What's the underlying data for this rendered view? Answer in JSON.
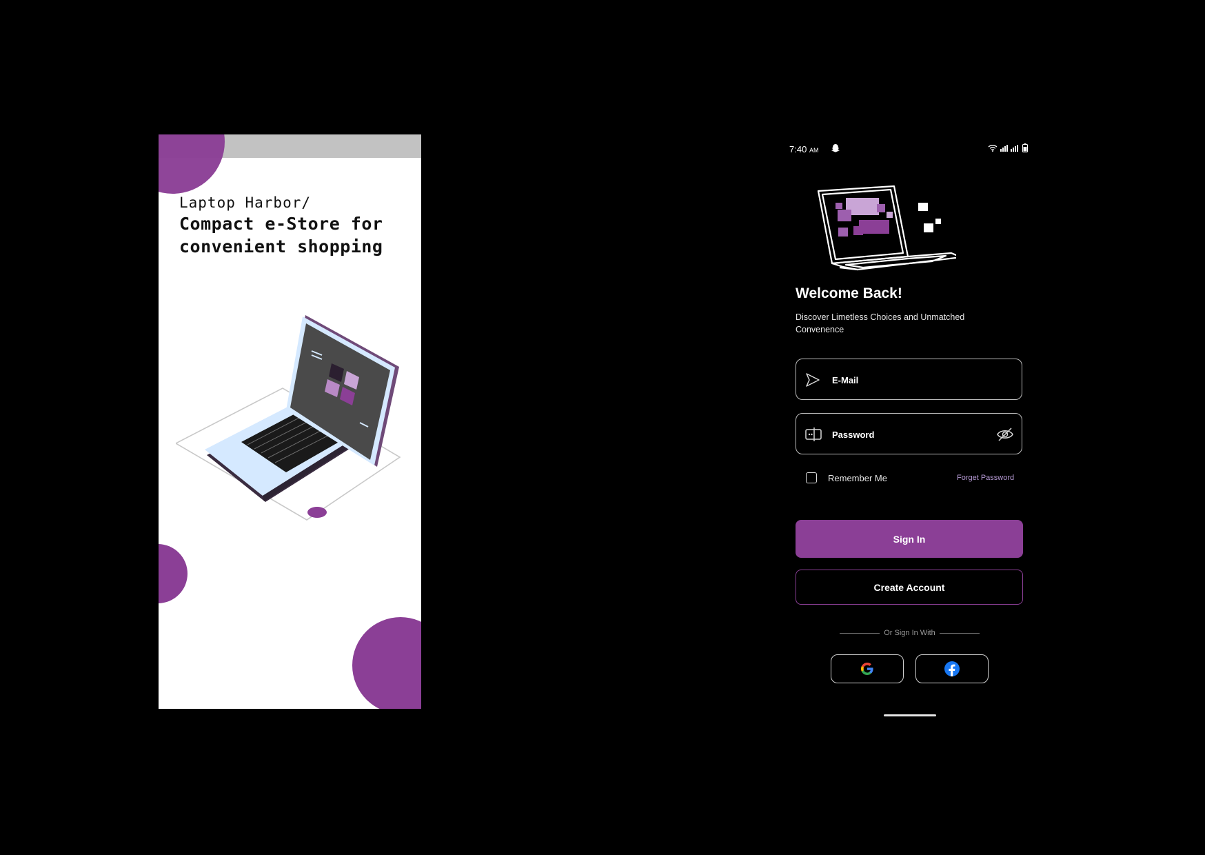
{
  "colors": {
    "brand_purple": "#8b3f96",
    "background": "#000000",
    "link": "#b79bd6"
  },
  "splash": {
    "brand": "Laptop Harbor/",
    "headline_line1": "Compact e-Store for",
    "headline_line2": "convenient shopping"
  },
  "login": {
    "status": {
      "time": "7:40",
      "ampm": "AM"
    },
    "title": "Welcome Back!",
    "subtitle": "Discover Limetless Choices and Unmatched Convenence",
    "email": {
      "placeholder": "E-Mail",
      "icon": "send-icon"
    },
    "password": {
      "placeholder": "Password",
      "icon": "password-icon",
      "toggle_icon": "eye-off-icon"
    },
    "remember_label": "Remember Me",
    "forget_label": "Forget Password",
    "signin_label": "Sign In",
    "create_label": "Create Account",
    "divider_label": "Or Sign In With",
    "social": [
      "google-icon",
      "facebook-icon"
    ]
  }
}
